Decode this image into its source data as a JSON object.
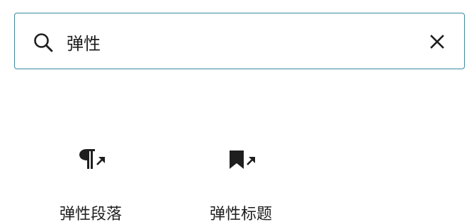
{
  "search": {
    "value": "弹性",
    "icon": "search-icon",
    "clear_icon": "close-icon"
  },
  "results": [
    {
      "label": "弹性段落",
      "icon": "paragraph-icon"
    },
    {
      "label": "弹性标题",
      "icon": "bookmark-icon"
    }
  ],
  "colors": {
    "focus_border": "#3a8aa0",
    "text": "#1e1e1e"
  }
}
